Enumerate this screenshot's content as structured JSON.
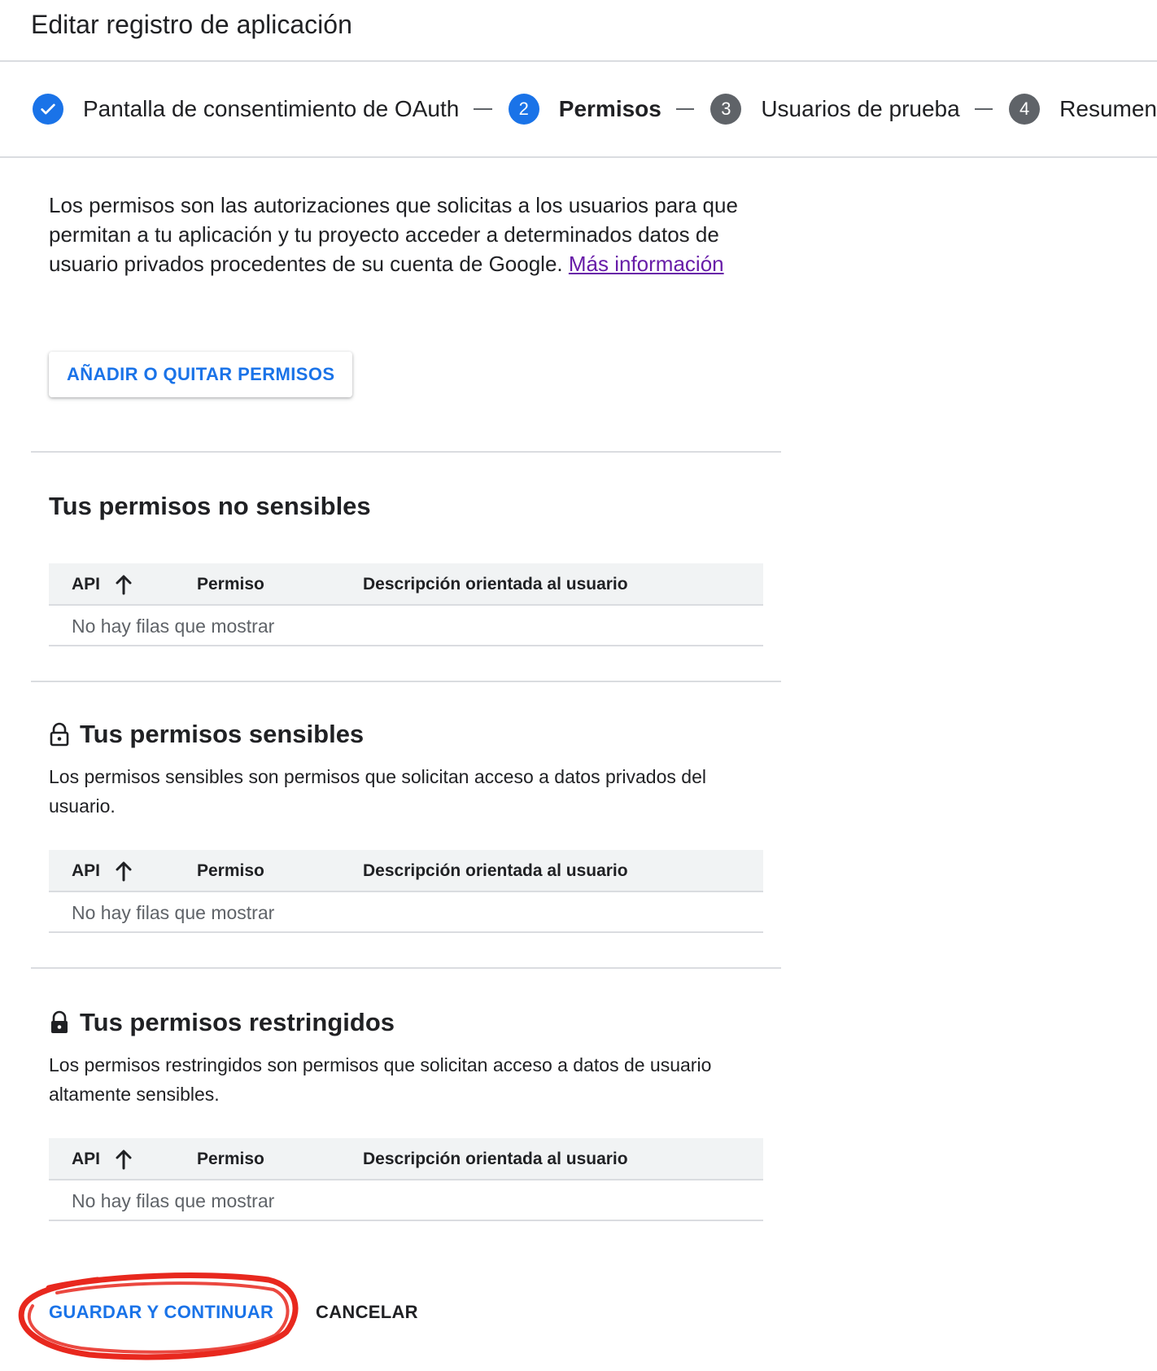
{
  "header": {
    "title": "Editar registro de aplicación"
  },
  "stepper": {
    "steps": [
      {
        "number": "",
        "label": "Pantalla de consentimiento de OAuth",
        "state": "done"
      },
      {
        "number": "2",
        "label": "Permisos",
        "state": "active"
      },
      {
        "number": "3",
        "label": "Usuarios de prueba",
        "state": "todo"
      },
      {
        "number": "4",
        "label": "Resumen",
        "state": "todo"
      }
    ]
  },
  "intro": {
    "text": "Los permisos son las autorizaciones que solicitas a los usuarios para que permitan a tu aplicación y tu proyecto acceder a determinados datos de usuario privados procedentes de su cuenta de Google. ",
    "link": "Más información"
  },
  "add_remove_button": "AÑADIR O QUITAR PERMISOS",
  "sections": {
    "non_sensitive": {
      "title": "Tus permisos no sensibles",
      "table": {
        "columns": [
          "API",
          "Permiso",
          "Descripción orientada al usuario"
        ],
        "empty": "No hay filas que mostrar"
      }
    },
    "sensitive": {
      "title": "Tus permisos sensibles",
      "description": "Los permisos sensibles son permisos que solicitan acceso a datos privados del usuario.",
      "table": {
        "columns": [
          "API",
          "Permiso",
          "Descripción orientada al usuario"
        ],
        "empty": "No hay filas que mostrar"
      }
    },
    "restricted": {
      "title": "Tus permisos restringidos",
      "description": "Los permisos restringidos son permisos que solicitan acceso a datos de usuario altamente sensibles.",
      "table": {
        "columns": [
          "API",
          "Permiso",
          "Descripción orientada al usuario"
        ],
        "empty": "No hay filas que mostrar"
      }
    }
  },
  "footer": {
    "save_label": "GUARDAR Y CONTINUAR",
    "cancel_label": "CANCELAR"
  },
  "colors": {
    "accent": "#1a73e8",
    "link_visited": "#681da8",
    "annotation": "#e8281e",
    "step_inactive": "#5f6368"
  },
  "icons": {
    "step_done": "check-circle-icon",
    "sort": "arrow-up-icon",
    "sensitive": "lock-open-icon",
    "restricted": "lock-icon"
  }
}
